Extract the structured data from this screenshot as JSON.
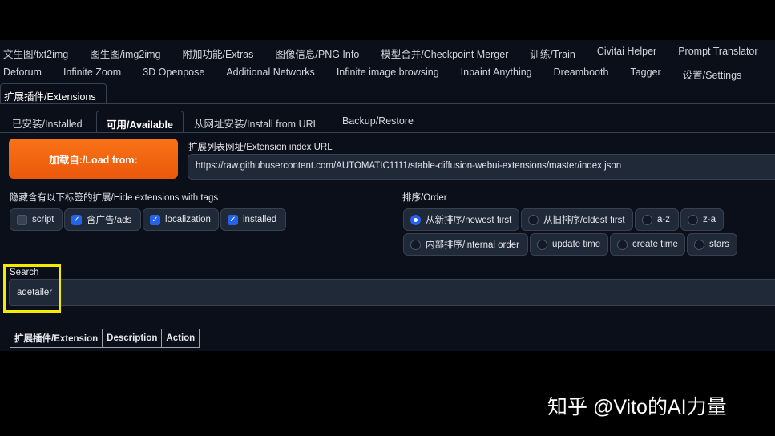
{
  "nav_row1": [
    "文生图/txt2img",
    "图生图/img2img",
    "附加功能/Extras",
    "图像信息/PNG Info",
    "模型合并/Checkpoint Merger",
    "训练/Train",
    "Civitai Helper",
    "Prompt Translator"
  ],
  "nav_row2": [
    "Deforum",
    "Infinite Zoom",
    "3D Openpose",
    "Additional Networks",
    "Infinite image browsing",
    "Inpaint Anything",
    "Dreambooth",
    "Tagger",
    "设置/Settings"
  ],
  "active_tab": "扩展插件/Extensions",
  "subtabs": [
    "已安装/Installed",
    "可用/Available",
    "从网址安装/Install from URL",
    "Backup/Restore"
  ],
  "load_button": "加载自:/Load from:",
  "index_url_label": "扩展列表网址/Extension index URL",
  "index_url": "https://raw.githubusercontent.com/AUTOMATIC1111/stable-diffusion-webui-extensions/master/index.json",
  "hide_label": "隐藏含有以下标签的扩展/Hide extensions with tags",
  "hide_tags": [
    {
      "label": "script",
      "checked": false
    },
    {
      "label": "含广告/ads",
      "checked": true
    },
    {
      "label": "localization",
      "checked": true
    },
    {
      "label": "installed",
      "checked": true
    }
  ],
  "order_label": "排序/Order",
  "order_options": [
    "从新排序/newest first",
    "从旧排序/oldest first",
    "a-z",
    "z-a",
    "内部排序/internal order",
    "update time",
    "create time",
    "stars"
  ],
  "order_selected": "从新排序/newest first",
  "search_label": "Search",
  "search_value": "adetailer",
  "table_headers": [
    "扩展插件/Extension",
    "Description",
    "Action"
  ],
  "watermark": "知乎 @Vito的AI力量"
}
